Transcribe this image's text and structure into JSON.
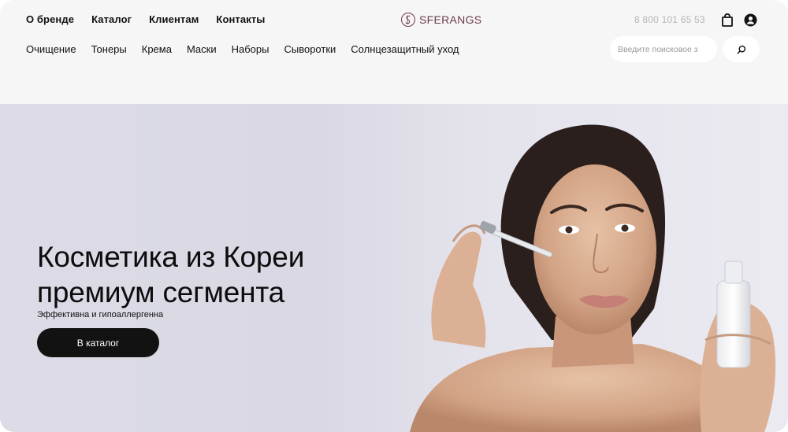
{
  "header": {
    "top_nav": [
      "О бренде",
      "Каталог",
      "Клиентам",
      "Контакты"
    ],
    "logo_text": "SFERANGS",
    "phone": "8 800 101 65 53",
    "categories": [
      "Очищение",
      "Тонеры",
      "Крема",
      "Маски",
      "Наборы",
      "Сыворотки",
      "Солнцезащитный уход"
    ],
    "search": {
      "placeholder": "Введите поисковое з"
    },
    "icons": {
      "cart": "shopping-bag-icon",
      "account": "user-account-icon",
      "search": "search-icon"
    }
  },
  "hero": {
    "title_line1": "Косметика из Кореи",
    "title_line2": "премиум сегмента",
    "subtitle": "Эффективна и гипоаллергенна",
    "cta_label": "В каталог"
  },
  "colors": {
    "brand": "#6e3a4a",
    "header_bg": "#f6f6f6",
    "hero_bg": "#dcdbe6",
    "button": "#121212",
    "phone_text": "#b5b5b5"
  }
}
